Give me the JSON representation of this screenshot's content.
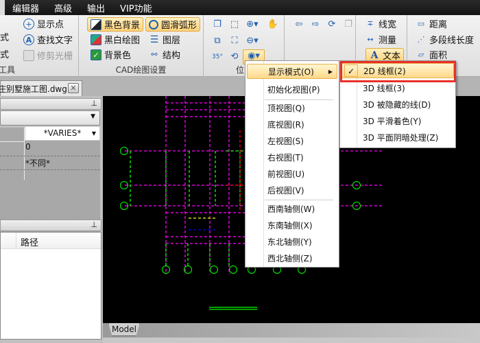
{
  "menubar": {
    "items": [
      "编辑器",
      "高级",
      "输出",
      "VIP功能"
    ]
  },
  "ribbon": {
    "group1": {
      "label": "工具",
      "btn1": "显示点",
      "btn2": "查找文字",
      "btn3": "修剪光栅",
      "cut1": "式",
      "cut2": "式"
    },
    "group2": {
      "label": "CAD绘图设置",
      "black_bg": "黑色背景",
      "smooth_arc": "圆滑弧形",
      "bw_draw": "黑白绘图",
      "layers": "图层",
      "bg_color": "背景色",
      "structure": "结构"
    },
    "group3": {
      "label": "位"
    },
    "group5": {
      "linewidth": "线宽",
      "measure": "测量",
      "text": "文本"
    },
    "group6": {
      "distance": "距离",
      "polyline_length": "多段线长度",
      "area": "面积"
    }
  },
  "document_tab": {
    "title": "庄别墅施工图.dwg"
  },
  "properties": {
    "dropdown_value": "*VARIES*",
    "row1_value": "0",
    "row2_value": "*不同*"
  },
  "files_panel": {
    "col_path": "路径"
  },
  "canvas": {
    "model_tab": "Model"
  },
  "context_menu": {
    "items": [
      "显示模式(O)",
      "初始化视图(P)",
      "顶视图(Q)",
      "底视图(R)",
      "左视图(S)",
      "右视图(T)",
      "前视图(U)",
      "后视图(V)",
      "西南轴侧(W)",
      "东南轴侧(X)",
      "东北轴侧(Y)",
      "西北轴侧(Z)"
    ]
  },
  "submenu": {
    "items": [
      "2D 线框(2)",
      "3D 线框(3)",
      "3D 被隐藏的线(D)",
      "3D 平滑着色(Y)",
      "3D 平面阴暗处理(Z)"
    ],
    "checked_index": 0
  },
  "colors": {
    "highlight_box": "#e8302a",
    "cad_green": "#00ff00",
    "cad_magenta": "#ff00ff",
    "accent": "#ffd27a"
  }
}
